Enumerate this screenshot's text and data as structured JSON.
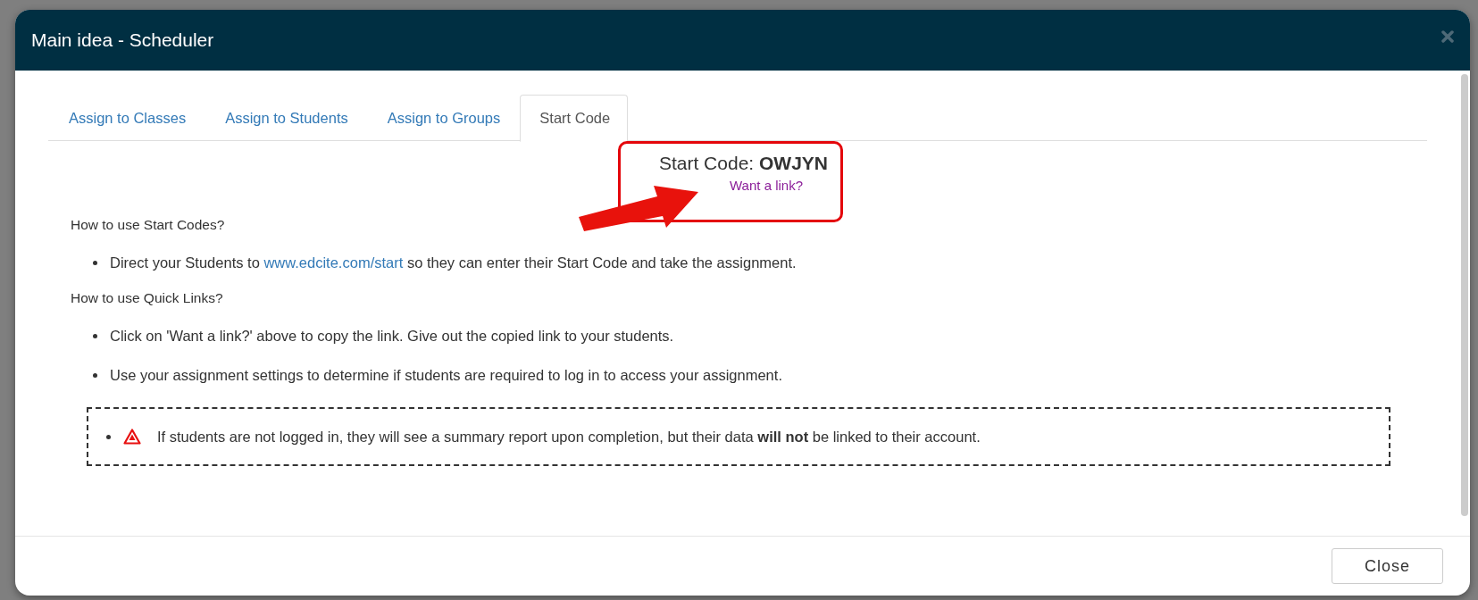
{
  "dialog": {
    "title": "Main idea - Scheduler",
    "tabs": [
      {
        "label": "Assign to Classes",
        "selected": false
      },
      {
        "label": "Assign to Students",
        "selected": false
      },
      {
        "label": "Assign to Groups",
        "selected": false
      },
      {
        "label": "Start Code",
        "selected": true
      }
    ],
    "start_code": {
      "label": "Start Code:",
      "code": "OWJYN",
      "link": "Want a link?"
    },
    "sections": [
      {
        "heading": "How to use Start Codes?",
        "items": [
          {
            "before": "Direct your Students to",
            "link": "www.edcite.com/start",
            "after": "so they can enter their Start Code and take the assignment."
          }
        ]
      },
      {
        "heading": "How to use Quick Links?",
        "items": [
          {
            "before": "Click on 'Want a link?' above to copy the link. Give out the copied link to your students."
          },
          {
            "before": "Use your assignment settings to determine if students are required to log in to access your assignment."
          }
        ]
      }
    ],
    "warning": {
      "text": "If students are not logged in, they will see a summary report upon completion, but their data **will not** be linked to their account."
    },
    "footer": {
      "button": "Close"
    }
  }
}
